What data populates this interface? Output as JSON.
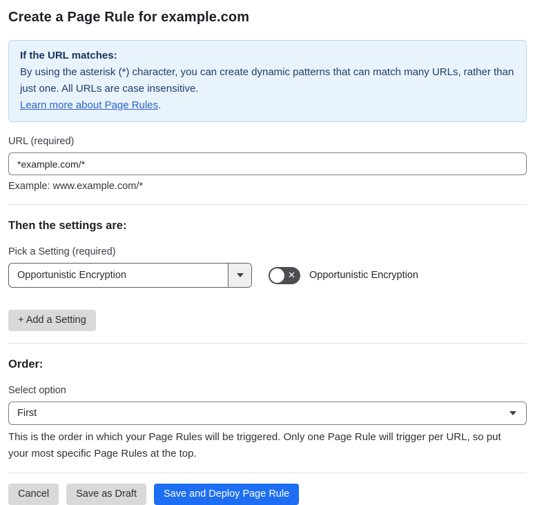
{
  "page": {
    "title": "Create a Page Rule for example.com"
  },
  "info_box": {
    "heading": "If the URL matches:",
    "body": "By using the asterisk (*) character, you can create dynamic patterns that can match many URLs, rather than just one. All URLs are case insensitive.",
    "link_label": "Learn more about Page Rules",
    "link_suffix": "."
  },
  "url_field": {
    "label": "URL (required)",
    "value": "*example.com/*",
    "helper": "Example: www.example.com/*"
  },
  "settings_section": {
    "heading": "Then the settings are:",
    "picker_label": "Pick a Setting (required)",
    "picker_value": "Opportunistic Encryption",
    "toggle_state": "off",
    "toggle_icon": "x-icon",
    "toggle_label": "Opportunistic Encryption",
    "add_setting_label": "+ Add a Setting"
  },
  "order_section": {
    "heading": "Order:",
    "select_label": "Select option",
    "select_value": "First",
    "helper": "This is the order in which your Page Rules will be triggered. Only one Page Rule will trigger per URL, so put your most specific Page Rules at the top."
  },
  "footer": {
    "cancel_label": "Cancel",
    "save_draft_label": "Save as Draft",
    "save_deploy_label": "Save and Deploy Page Rule"
  },
  "colors": {
    "info_box_bg": "#e9f3fc",
    "info_box_border": "#b7d8f4",
    "info_text": "#1d3c6e",
    "link_blue": "#2b62c9",
    "primary_button_blue": "#1d6ef2",
    "secondary_button_gray": "#d9d9d9",
    "toggle_off_bg": "#4c4d50",
    "input_border": "#7d7d80"
  }
}
